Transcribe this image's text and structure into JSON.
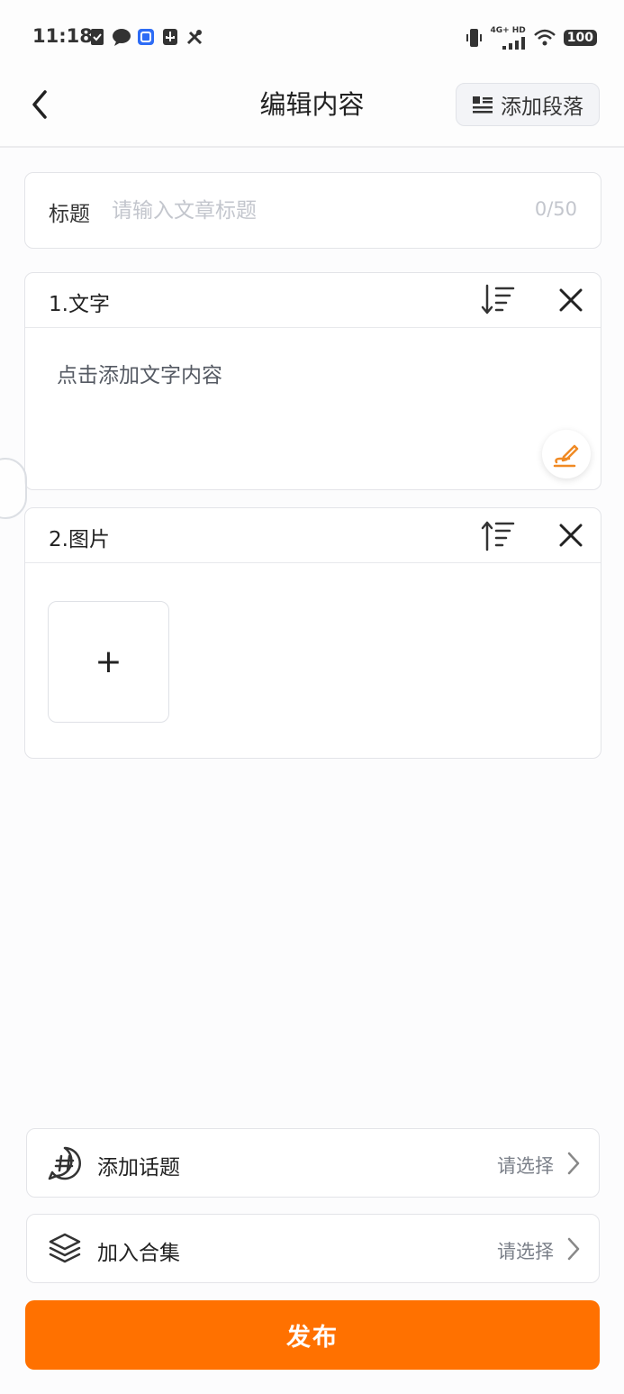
{
  "status_bar": {
    "time": "11:18",
    "network_label": "4G+ HD",
    "battery": "100",
    "icons": [
      "shield-check-icon",
      "chat-bubble-icon",
      "app-badge-icon",
      "usb-icon",
      "tools-icon",
      "vibrate-icon",
      "signal-icon",
      "wifi-icon",
      "battery-icon"
    ]
  },
  "nav": {
    "title": "编辑内容",
    "add_paragraph_label": "添加段落",
    "back_icon": "chevron-left-icon",
    "add_paragraph_icon": "list-icon"
  },
  "title_field": {
    "label": "标题",
    "placeholder": "请输入文章标题",
    "value": "",
    "counter": "0/50"
  },
  "sections": [
    {
      "title": "1.文字",
      "type": "text",
      "placeholder": "点击添加文字内容",
      "sort_icon": "sort-down-icon",
      "close_icon": "close-icon"
    },
    {
      "title": "2.图片",
      "type": "image",
      "add_symbol": "+",
      "sort_icon": "sort-up-icon",
      "close_icon": "close-icon"
    }
  ],
  "options": {
    "topic": {
      "label": "添加话题",
      "value": "请选择",
      "icon": "hashtag-bubble-icon"
    },
    "collection": {
      "label": "加入合集",
      "value": "请选择",
      "icon": "layers-icon"
    }
  },
  "publish_label": "发布",
  "colors": {
    "accent": "#ff7100",
    "background": "#fcfcfd",
    "border": "#e3e4e8",
    "placeholder": "#c3c6cd"
  }
}
